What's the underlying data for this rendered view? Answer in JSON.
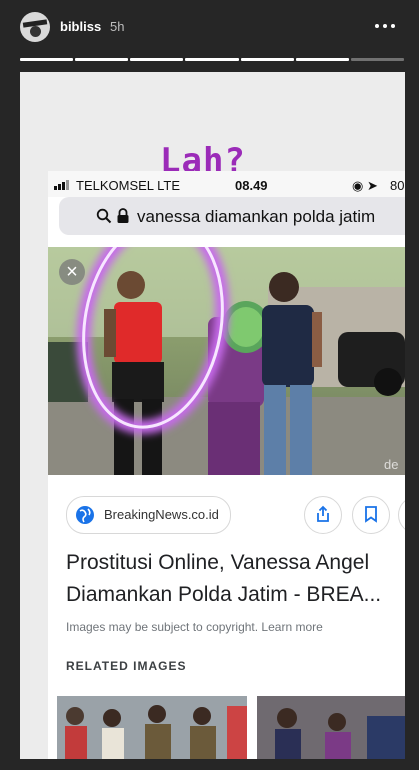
{
  "story": {
    "username": "bibliss",
    "time": "5h",
    "caption": "Lah?",
    "segments_total": 7,
    "segments_done": 6
  },
  "screenshot": {
    "statusbar": {
      "carrier": "TELKOMSEL  LTE",
      "time": "08.49",
      "battery": "80"
    },
    "search": {
      "query": "vanessa diamankan polda jatim"
    },
    "watermark": "de",
    "source": "BreakingNews.co.id",
    "headline": [
      "Prostitusi Online, Vanessa Angel",
      "Diamankan Polda Jatim - BREA..."
    ],
    "copyright": "Images may be subject to copyright. Learn more",
    "related_title": "RELATED IMAGES"
  },
  "colors": {
    "caption": "#9b2bb8",
    "highlight_circle": "#d580f0",
    "link_blue": "#1a73e8"
  },
  "icons": [
    "avatar",
    "more-icon",
    "search-icon",
    "lock-icon",
    "close-icon",
    "globe-icon",
    "share-icon",
    "bookmark-icon"
  ]
}
